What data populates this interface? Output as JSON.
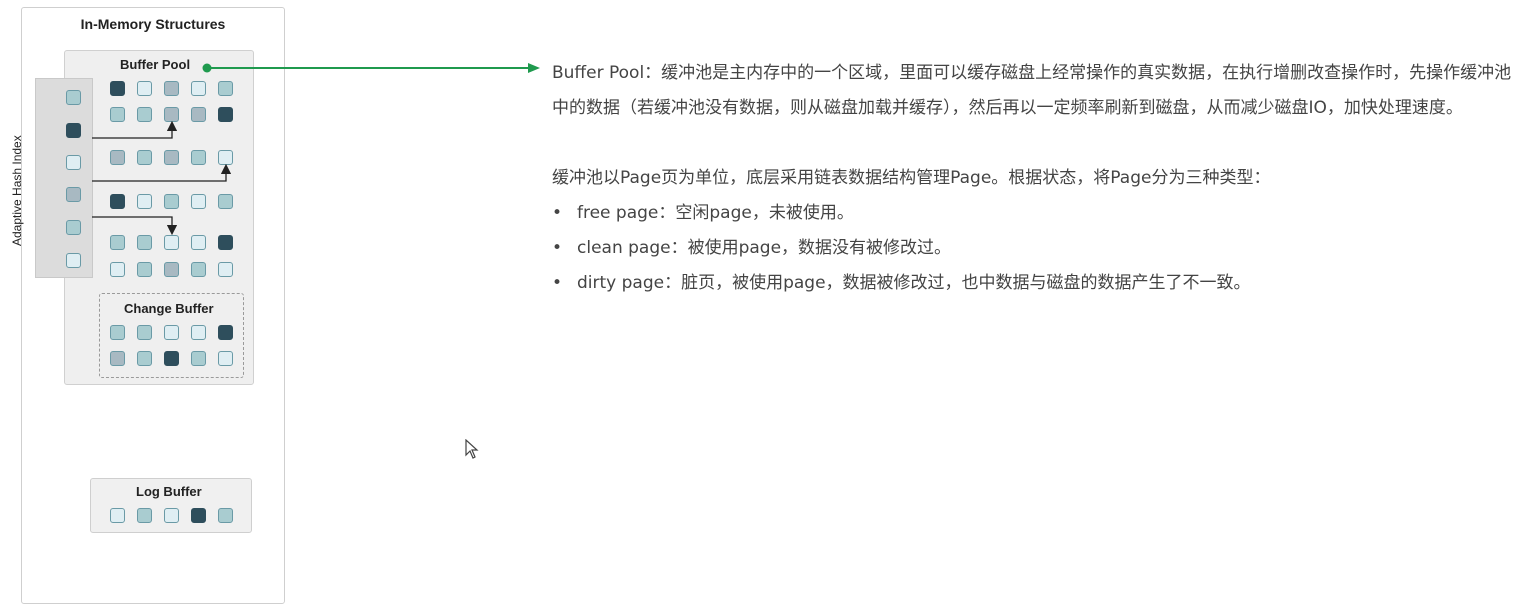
{
  "diagram": {
    "panel_title": "In-Memory Structures",
    "buffer_pool_title": "Buffer Pool",
    "ahi_label": "Adaptive Hash Index",
    "change_buffer_title": "Change Buffer",
    "log_buffer_title": "Log Buffer"
  },
  "description": {
    "p1": "Buffer Pool：缓冲池是主内存中的一个区域，里面可以缓存磁盘上经常操作的真实数据，在执行增删改查操作时，先操作缓冲池中的数据（若缓冲池没有数据，则从磁盘加载并缓存），然后再以一定频率刷新到磁盘，从而减少磁盘IO，加快处理速度。",
    "intro": "缓冲池以Page页为单位，底层采用链表数据结构管理Page。根据状态，将Page分为三种类型：",
    "bullets": [
      "free page：空闲page，未被使用。",
      "clean page：被使用page，数据没有被修改过。",
      "dirty page：脏页，被使用page，数据被修改过，也中数据与磁盘的数据产生了不一致。"
    ],
    "bullet_mark": "•"
  },
  "colors": {
    "arrow": "#1f9a4e",
    "page_dark": "#2e4e5c",
    "page_mid": "#a9ccd0",
    "page_light": "#dfeef3",
    "page_grey": "#a8b9c2"
  },
  "icons": {
    "cursor": "mouse-pointer-icon"
  }
}
